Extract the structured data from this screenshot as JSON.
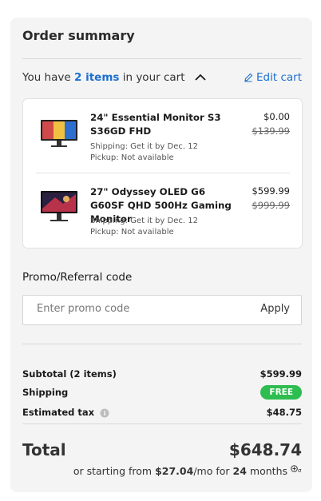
{
  "summary": {
    "title": "Order summary",
    "cart_prefix": "You have",
    "cart_count": "2 items",
    "cart_suffix": "in your cart",
    "edit_cart": "Edit cart"
  },
  "items": [
    {
      "name": "24\" Essential Monitor S3 S36GD FHD",
      "shipping": "Shipping: Get it by Dec. 12",
      "pickup": "Pickup: Not available",
      "price": "$0.00",
      "original_price": "$139.99"
    },
    {
      "name": "27\" Odyssey OLED G6 G60SF QHD 500Hz Gaming Monitor",
      "shipping": "Shipping: Get it by Dec. 12",
      "pickup": "Pickup: Not available",
      "price": "$599.99",
      "original_price": "$999.99"
    }
  ],
  "promo": {
    "label": "Promo/Referral code",
    "placeholder": "Enter promo code",
    "apply": "Apply"
  },
  "totals": {
    "subtotal_label": "Subtotal (2 items)",
    "subtotal_value": "$599.99",
    "shipping_label": "Shipping",
    "shipping_value": "FREE",
    "tax_label": "Estimated tax",
    "tax_value": "$48.75",
    "total_label": "Total",
    "total_value": "$648.74",
    "financing_prefix": "or starting from",
    "financing_amount": "$27.04",
    "financing_mid": "/mo for",
    "financing_months": "24",
    "financing_suffix": "months"
  },
  "colors": {
    "accent": "#1b6fd1",
    "free_badge": "#2ebd4f",
    "panel_bg": "#f4f4f4"
  }
}
